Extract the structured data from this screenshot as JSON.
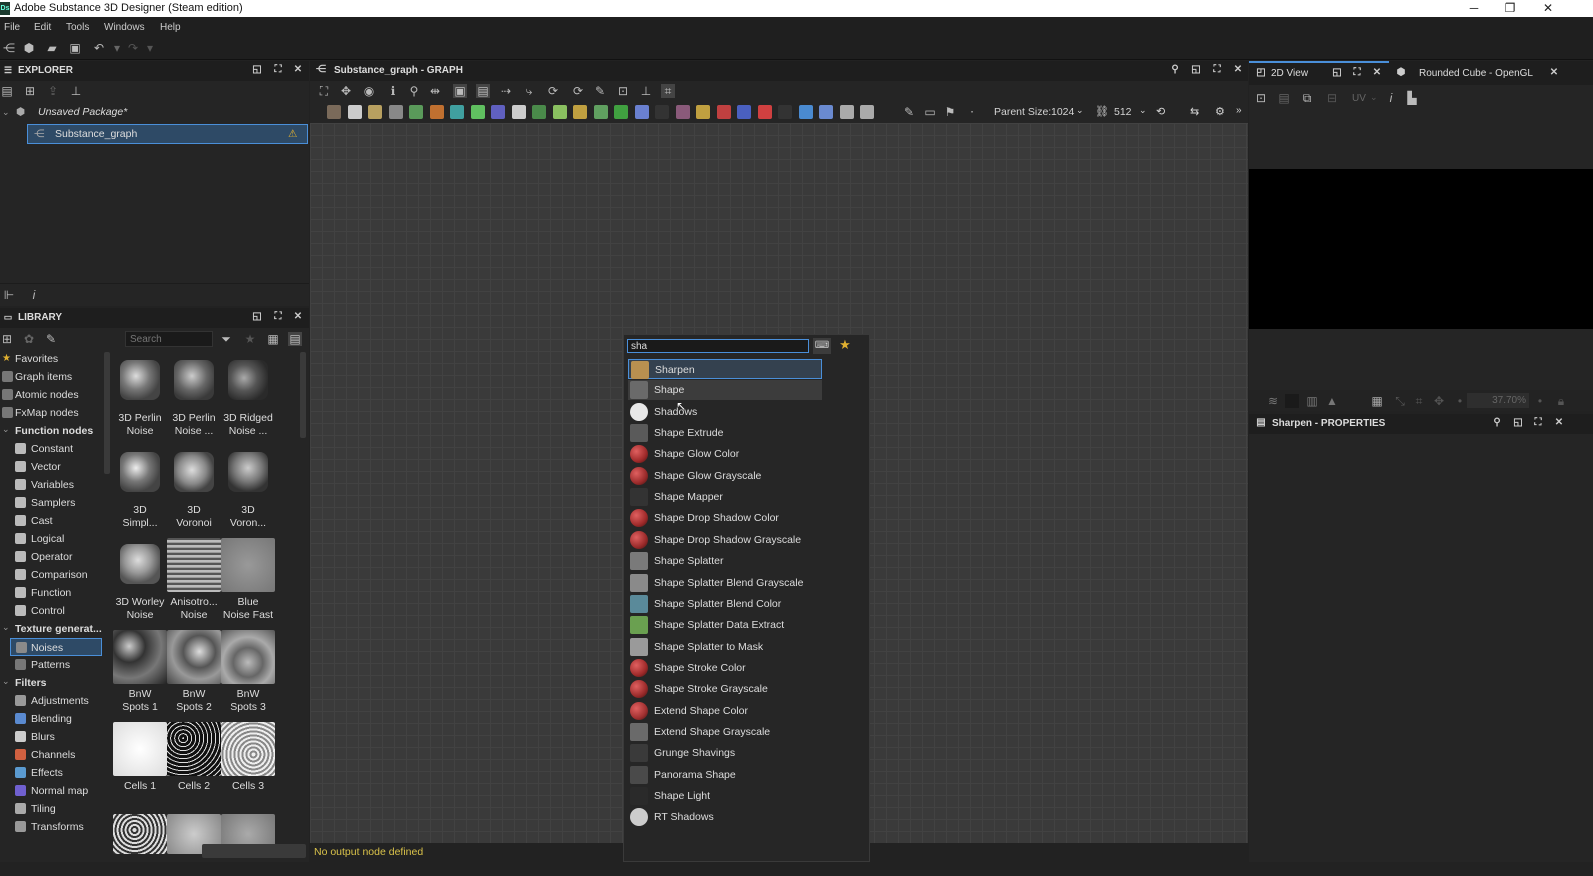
{
  "app": {
    "title": "Adobe Substance 3D Designer (Steam edition)",
    "logo": "Ds"
  },
  "window_controls": {
    "minimize": "─",
    "maximize": "❐",
    "close": "✕"
  },
  "menu": [
    "File",
    "Edit",
    "Tools",
    "Windows",
    "Help"
  ],
  "explorer": {
    "title": "EXPLORER",
    "package": "Unsaved Package*",
    "graph": "Substance_graph",
    "warning": "⚠"
  },
  "library": {
    "title": "LIBRARY",
    "search_placeholder": "Search",
    "categories": [
      {
        "label": "Favorites",
        "indent": 0,
        "icon": "star-icon",
        "bold": false
      },
      {
        "label": "Graph items",
        "indent": 0,
        "icon": "graph-items-icon",
        "bold": false
      },
      {
        "label": "Atomic nodes",
        "indent": 0,
        "icon": "atomic-icon",
        "bold": false
      },
      {
        "label": "FxMap nodes",
        "indent": 0,
        "icon": "fxmap-icon",
        "bold": false
      },
      {
        "label": "Function nodes",
        "indent": 0,
        "icon": "caret-icon",
        "bold": true
      },
      {
        "label": "Constant",
        "indent": 1,
        "icon": "function-icon",
        "bold": false
      },
      {
        "label": "Vector",
        "indent": 1,
        "icon": "function-icon",
        "bold": false
      },
      {
        "label": "Variables",
        "indent": 1,
        "icon": "function-icon",
        "bold": false
      },
      {
        "label": "Samplers",
        "indent": 1,
        "icon": "function-icon",
        "bold": false
      },
      {
        "label": "Cast",
        "indent": 1,
        "icon": "function-icon",
        "bold": false
      },
      {
        "label": "Logical",
        "indent": 1,
        "icon": "function-icon",
        "bold": false
      },
      {
        "label": "Operator",
        "indent": 1,
        "icon": "function-icon",
        "bold": false
      },
      {
        "label": "Comparison",
        "indent": 1,
        "icon": "function-icon",
        "bold": false
      },
      {
        "label": "Function",
        "indent": 1,
        "icon": "function-icon",
        "bold": false
      },
      {
        "label": "Control",
        "indent": 1,
        "icon": "function-icon",
        "bold": false
      },
      {
        "label": "Texture generat...",
        "indent": 0,
        "icon": "caret-icon",
        "bold": true
      },
      {
        "label": "Noises",
        "indent": 1,
        "icon": "noise-icon",
        "bold": false
      },
      {
        "label": "Patterns",
        "indent": 1,
        "icon": "pattern-icon",
        "bold": false
      },
      {
        "label": "Filters",
        "indent": 0,
        "icon": "caret-icon",
        "bold": true
      },
      {
        "label": "Adjustments",
        "indent": 1,
        "icon": "adjust-icon",
        "bold": false
      },
      {
        "label": "Blending",
        "indent": 1,
        "icon": "blend-icon",
        "bold": false
      },
      {
        "label": "Blurs",
        "indent": 1,
        "icon": "blur-icon",
        "bold": false
      },
      {
        "label": "Channels",
        "indent": 1,
        "icon": "channels-icon",
        "bold": false
      },
      {
        "label": "Effects",
        "indent": 1,
        "icon": "effects-icon",
        "bold": false
      },
      {
        "label": "Normal map",
        "indent": 1,
        "icon": "normal-map-icon",
        "bold": false
      },
      {
        "label": "Tiling",
        "indent": 1,
        "icon": "tiling-icon",
        "bold": false
      },
      {
        "label": "Transforms",
        "indent": 1,
        "icon": "transforms-icon",
        "bold": false
      }
    ],
    "thumbs": [
      {
        "l1": "3D Perlin",
        "l2": "Noise"
      },
      {
        "l1": "3D Perlin",
        "l2": "Noise ..."
      },
      {
        "l1": "3D Ridged",
        "l2": "Noise ..."
      },
      {
        "l1": "3D",
        "l2": "Simpl..."
      },
      {
        "l1": "3D",
        "l2": "Voronoi"
      },
      {
        "l1": "3D",
        "l2": "Voron..."
      },
      {
        "l1": "3D Worley",
        "l2": "Noise"
      },
      {
        "l1": "Anisotro...",
        "l2": "Noise"
      },
      {
        "l1": "Blue",
        "l2": "Noise Fast"
      },
      {
        "l1": "BnW",
        "l2": "Spots 1"
      },
      {
        "l1": "BnW",
        "l2": "Spots 2"
      },
      {
        "l1": "BnW",
        "l2": "Spots 3"
      },
      {
        "l1": "Cells 1",
        "l2": ""
      },
      {
        "l1": "Cells 2",
        "l2": ""
      },
      {
        "l1": "Cells 3",
        "l2": ""
      }
    ]
  },
  "graph": {
    "title": "Substance_graph - GRAPH",
    "parent_size_label": "Parent Size:",
    "parent_size": "1024",
    "output_size": "512",
    "status": "No output node defined"
  },
  "node_search": {
    "query": "sha",
    "results": [
      {
        "label": "Sharpen",
        "color": "#b89050"
      },
      {
        "label": "Shape",
        "color": "#6a6a6a"
      },
      {
        "label": "Shadows",
        "color": "#e8e8e8"
      },
      {
        "label": "Shape Extrude",
        "color": "#5a5a5a"
      },
      {
        "label": "Shape Glow Color",
        "color": "#a02a2a"
      },
      {
        "label": "Shape Glow Grayscale",
        "color": "#9a2a2a"
      },
      {
        "label": "Shape Mapper",
        "color": "#333333"
      },
      {
        "label": "Shape Drop Shadow Color",
        "color": "#a02a2a"
      },
      {
        "label": "Shape Drop Shadow Grayscale",
        "color": "#9a2a2a"
      },
      {
        "label": "Shape Splatter",
        "color": "#7a7a7a"
      },
      {
        "label": "Shape Splatter Blend Grayscale",
        "color": "#8a8a8a"
      },
      {
        "label": "Shape Splatter Blend Color",
        "color": "#5a8a9a"
      },
      {
        "label": "Shape Splatter Data Extract",
        "color": "#6aa050"
      },
      {
        "label": "Shape Splatter to Mask",
        "color": "#9a9a9a"
      },
      {
        "label": "Shape Stroke Color",
        "color": "#a02a2a"
      },
      {
        "label": "Shape Stroke Grayscale",
        "color": "#9a2a2a"
      },
      {
        "label": "Extend Shape Color",
        "color": "#a03030"
      },
      {
        "label": "Extend Shape Grayscale",
        "color": "#6a6a6a"
      },
      {
        "label": "Grunge Shavings",
        "color": "#3a3a3a"
      },
      {
        "label": "Panorama Shape",
        "color": "#4a4a4a"
      },
      {
        "label": "Shape Light",
        "color": "#2a2a2a"
      },
      {
        "label": "RT Shadows",
        "color": "#cccccc"
      }
    ]
  },
  "view2d": {
    "title": "2D View",
    "uv": "UV",
    "zoom": "37.70%"
  },
  "view3d": {
    "title": "Rounded Cube - OpenGL"
  },
  "properties": {
    "title": "Sharpen - PROPERTIES"
  },
  "colors": {
    "accent": "#4a8fd9",
    "warning": "#e0b030",
    "status": "#d9c24a",
    "selection": "#2e4a66"
  }
}
